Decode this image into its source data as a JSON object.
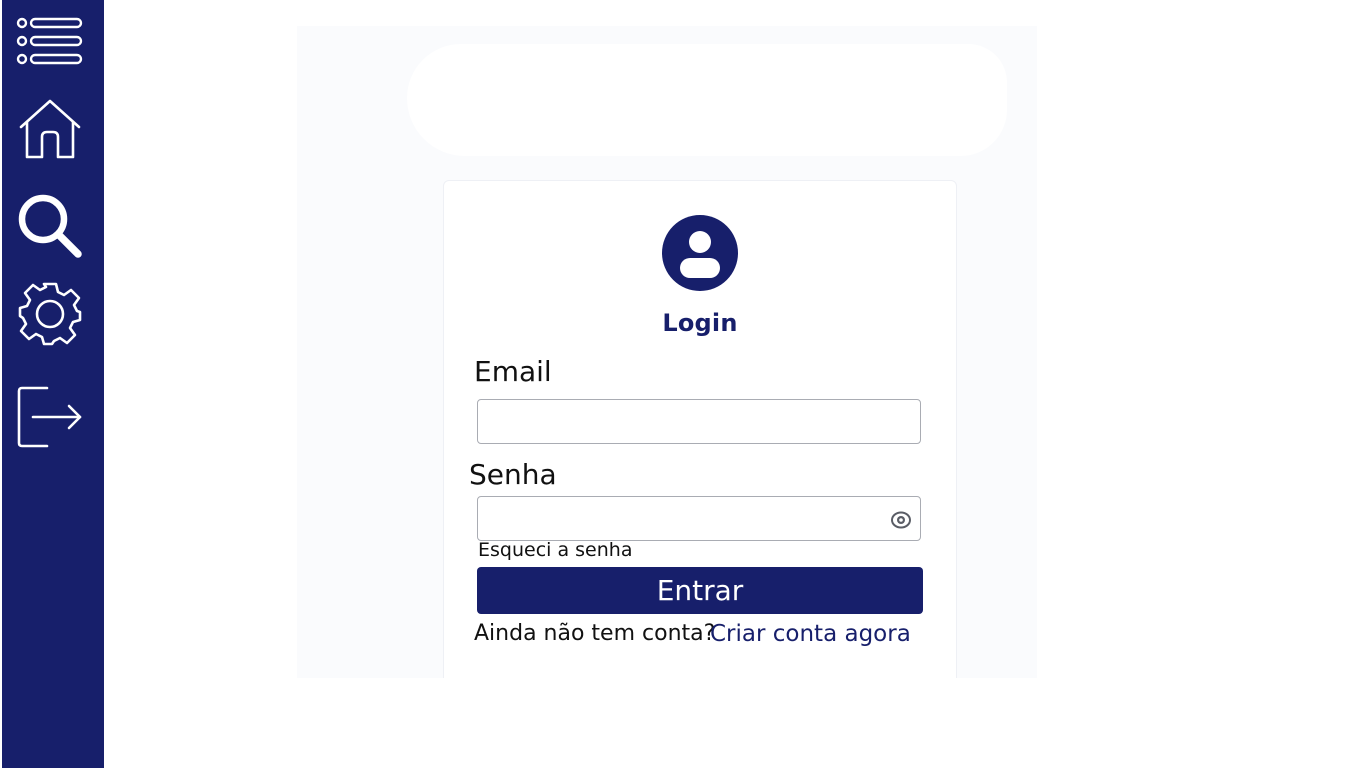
{
  "sidebar": {
    "items": [
      {
        "icon": "list-icon"
      },
      {
        "icon": "home-icon"
      },
      {
        "icon": "search-icon"
      },
      {
        "icon": "gear-icon"
      },
      {
        "icon": "logout-icon"
      }
    ],
    "background": "#171f6b"
  },
  "login": {
    "title": "Login",
    "email_label": "Email",
    "email_value": "",
    "password_label": "Senha",
    "password_value": "",
    "forgot_link": "Esqueci a senha",
    "submit_label": "Entrar",
    "signup_prompt": "Ainda não tem conta?",
    "signup_link": "Criar conta agora"
  },
  "colors": {
    "accent": "#171f6b",
    "page_background": "#fafbfd",
    "input_border": "#a9acb3"
  }
}
